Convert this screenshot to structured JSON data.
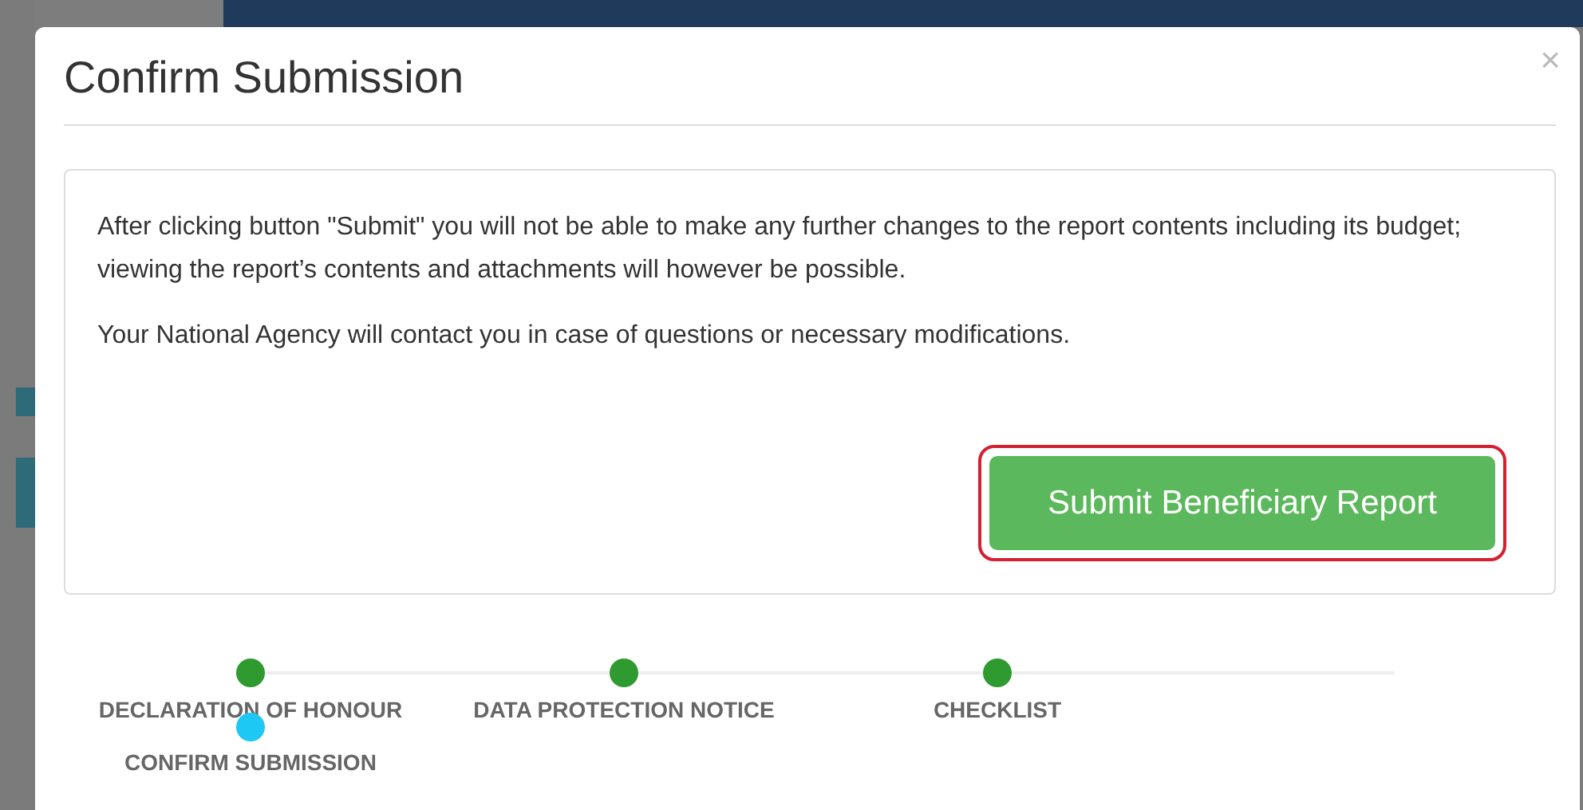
{
  "dialog": {
    "title": "Confirm Submission",
    "close": "×",
    "paragraphs": [
      "After clicking button \"Submit\" you will not be able to make any further changes to the report contents including its budget; viewing the report’s contents and attachments will however be possible.",
      "Your National Agency will contact you in case of questions or necessary modifications."
    ],
    "submit_button": {
      "label": "Submit Beneficiary Report",
      "highlighted": true
    }
  },
  "steps": [
    {
      "label": "DECLARATION OF HONOUR",
      "completed": true
    },
    {
      "label": "DATA PROTECTION NOTICE",
      "completed": true
    },
    {
      "label": "CHECKLIST",
      "completed": true
    },
    {
      "label": "CONFIRM SUBMISSION",
      "completed": false
    }
  ]
}
